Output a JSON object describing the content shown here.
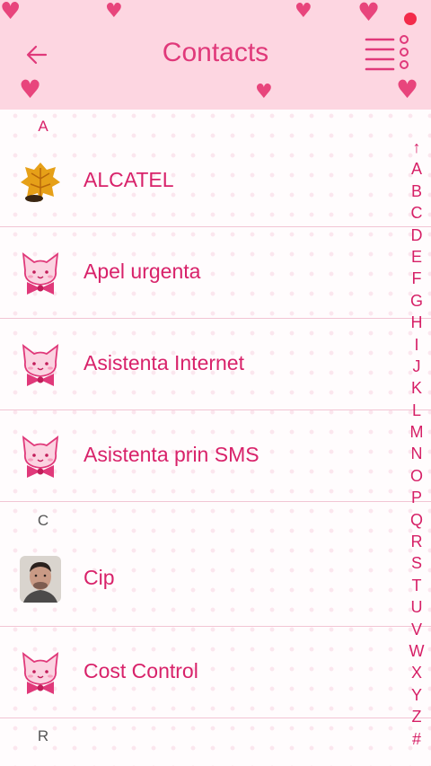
{
  "header": {
    "title": "Contacts",
    "back_icon": "arrow-left-icon",
    "menu_icon": "list-menu-icon",
    "notification_dot_color": "#f32b4a",
    "background": "#fdd6e1",
    "accent": "#e0397a"
  },
  "sections": [
    {
      "letter": "A",
      "color": "#d8226a"
    },
    {
      "letter": "C",
      "color": "#555555"
    },
    {
      "letter": "R",
      "color": "#555555"
    }
  ],
  "contacts": [
    {
      "name": "ALCATEL",
      "avatar": "autumn-leaf-photo"
    },
    {
      "name": "Apel urgenta",
      "avatar": "pink-cat-icon"
    },
    {
      "name": "Asistenta Internet",
      "avatar": "pink-cat-icon"
    },
    {
      "name": "Asistenta prin SMS",
      "avatar": "pink-cat-icon"
    },
    {
      "name": "Cip",
      "avatar": "person-photo"
    },
    {
      "name": "Cost Control",
      "avatar": "pink-cat-icon"
    }
  ],
  "index": [
    "↑",
    "A",
    "B",
    "C",
    "D",
    "E",
    "F",
    "G",
    "H",
    "I",
    "J",
    "K",
    "L",
    "M",
    "N",
    "O",
    "P",
    "Q",
    "R",
    "S",
    "T",
    "U",
    "V",
    "W",
    "X",
    "Y",
    "Z",
    "#"
  ]
}
